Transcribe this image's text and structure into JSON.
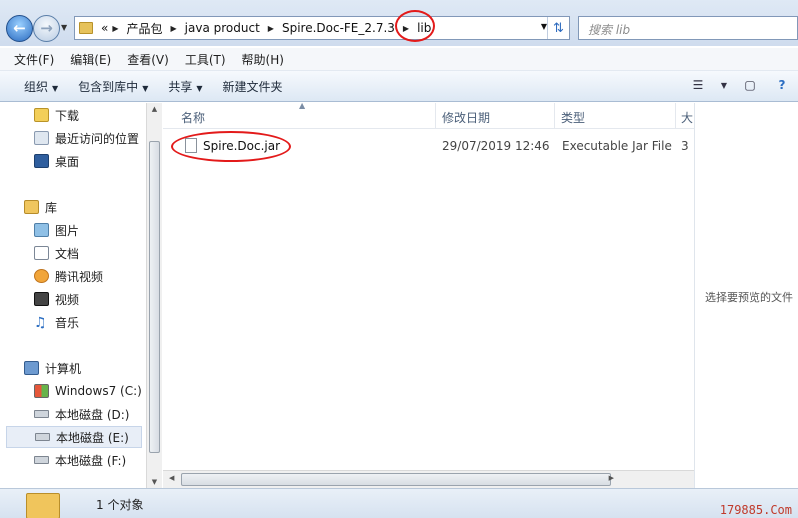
{
  "address": {
    "overflow": "«",
    "crumbs": [
      "产品包",
      "java product",
      "Spire.Doc-FE_2.7.3",
      "lib"
    ]
  },
  "search": {
    "placeholder": "搜索 lib"
  },
  "menu": [
    "文件(F)",
    "编辑(E)",
    "查看(V)",
    "工具(T)",
    "帮助(H)"
  ],
  "toolbar": [
    "组织",
    "包含到库中",
    "共享",
    "新建文件夹"
  ],
  "nav": {
    "favorites": [
      "下载",
      "最近访问的位置",
      "桌面"
    ],
    "libraries_label": "库",
    "libraries": [
      "图片",
      "文档",
      "腾讯视频",
      "视频",
      "音乐"
    ],
    "computer_label": "计算机",
    "drives": [
      "Windows7 (C:)",
      "本地磁盘 (D:)",
      "本地磁盘 (E:)",
      "本地磁盘 (F:)"
    ]
  },
  "columns": [
    "名称",
    "修改日期",
    "类型",
    "大"
  ],
  "files": [
    {
      "name": "Spire.Doc.jar",
      "date": "29/07/2019 12:46",
      "type": "Executable Jar File",
      "size": "3"
    }
  ],
  "preview_text": "选择要预览的文件",
  "status": {
    "count": "1 个对象"
  },
  "watermark": "179885.Com",
  "colors": {
    "highlight_circle": "#e31a1a",
    "toolbar_bg": "#dde8f4"
  }
}
